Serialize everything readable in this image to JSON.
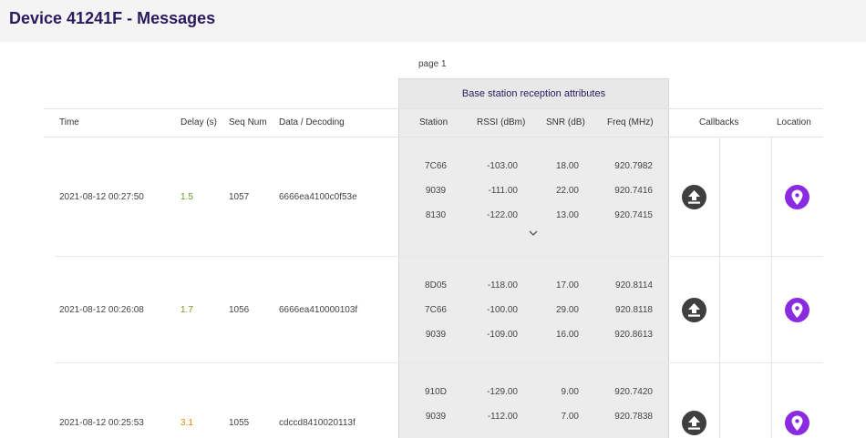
{
  "page": {
    "title": "Device 41241F - Messages",
    "pagination": "page 1"
  },
  "table": {
    "group_header": "Base station reception attributes",
    "columns": {
      "time": "Time",
      "delay": "Delay (s)",
      "seq": "Seq Num",
      "data": "Data / Decoding",
      "station": "Station",
      "rssi": "RSSI (dBm)",
      "snr": "SNR (dB)",
      "freq": "Freq (MHz)",
      "callbacks": "Callbacks",
      "location": "Location"
    },
    "rows": [
      {
        "time": "2021-08-12 00:27:50",
        "delay": "1.5",
        "delay_color": "#6c9a1a",
        "seq": "1057",
        "data": "6666ea4100c0f53e",
        "stations": [
          {
            "station": "7C66",
            "rssi": "-103.00",
            "snr": "18.00",
            "freq": "920.7982"
          },
          {
            "station": "9039",
            "rssi": "-111.00",
            "snr": "22.00",
            "freq": "920.7416"
          },
          {
            "station": "8130",
            "rssi": "-122.00",
            "snr": "13.00",
            "freq": "920.7415"
          }
        ],
        "expand_icon": "chevron-down-icon"
      },
      {
        "time": "2021-08-12 00:26:08",
        "delay": "1.7",
        "delay_color": "#6c9a1a",
        "seq": "1056",
        "data": "6666ea410000103f",
        "stations": [
          {
            "station": "8D05",
            "rssi": "-118.00",
            "snr": "17.00",
            "freq": "920.8114"
          },
          {
            "station": "7C66",
            "rssi": "-100.00",
            "snr": "29.00",
            "freq": "920.8118"
          },
          {
            "station": "9039",
            "rssi": "-109.00",
            "snr": "16.00",
            "freq": "920.8613"
          }
        ]
      },
      {
        "time": "2021-08-12 00:25:53",
        "delay": "3.1",
        "delay_color": "#e08a00",
        "seq": "1055",
        "data": "cdccd8410020113f",
        "stations": [
          {
            "station": "910D",
            "rssi": "-129.00",
            "snr": "9.00",
            "freq": "920.7420"
          },
          {
            "station": "9039",
            "rssi": "-112.00",
            "snr": "7.00",
            "freq": "920.7838"
          }
        ]
      }
    ]
  },
  "icons": {
    "callback": "upload-icon",
    "location": "map-pin-icon"
  },
  "colors": {
    "title": "#2a1a5e",
    "location_button": "#8a2be2",
    "callback_button": "#3f3f3f"
  }
}
